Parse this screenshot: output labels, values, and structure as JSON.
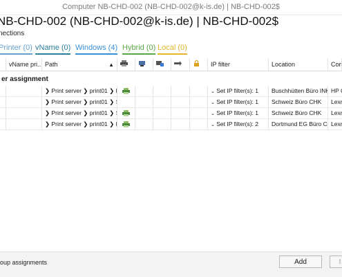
{
  "window": {
    "title": "Computer NB-CHD-002 (NB-CHD-002@k-is.de) | NB-CHD-002$",
    "heading": "NB-CHD-002 (NB-CHD-002@k-is.de) | NB-CHD-002$",
    "subtitle": "nections"
  },
  "tabs": [
    {
      "label": "Printer (0)",
      "color": "#6aa0cf"
    },
    {
      "label": "vName (0)",
      "color": "#2f7f9f"
    },
    {
      "label": "Windows (4)",
      "color": "#3b8fd6"
    },
    {
      "label": "Hybrid (0)",
      "color": "#59a847"
    },
    {
      "label": "Local (0)",
      "color": "#e2b52c"
    }
  ],
  "columns": {
    "vname": "vName pri...",
    "path": "Path",
    "ip_filter": "IP filter",
    "location": "Location",
    "comment": "Com"
  },
  "icons": {
    "col_printer": "printer-icon",
    "col_network": "network-printer-icon",
    "col_share": "shared-printer-icon",
    "col_default": "default-icon",
    "col_lock": "lock-icon"
  },
  "group": {
    "label": "er assignment"
  },
  "rows": [
    {
      "path": "❯ Print server ❯ print01 ❯ B...",
      "printer_icon": true,
      "ip": "Set IP filter(s): 1",
      "location": "Buschhütten Büro INK",
      "comment": "HP C"
    },
    {
      "path": "❯ Print server ❯ print01 ❯ S...",
      "printer_icon": false,
      "ip": "Set IP filter(s): 1",
      "location": "Schweiz Büro CHK",
      "comment": "Lexm"
    },
    {
      "path": "❯ Print server ❯ print01 ❯ S...",
      "printer_icon": true,
      "ip": "Set IP filter(s): 1",
      "location": "Schweiz Büro CHK",
      "comment": "Lexm"
    },
    {
      "path": "❯ Print server ❯ print01 ❯ D...",
      "printer_icon": true,
      "ip": "Set IP filter(s): 2",
      "location": "Dortmund EG Büro C...",
      "comment": "Lexm"
    }
  ],
  "footer": {
    "group_label": "oup assignments",
    "add_label": "Add",
    "next_label": "I"
  }
}
